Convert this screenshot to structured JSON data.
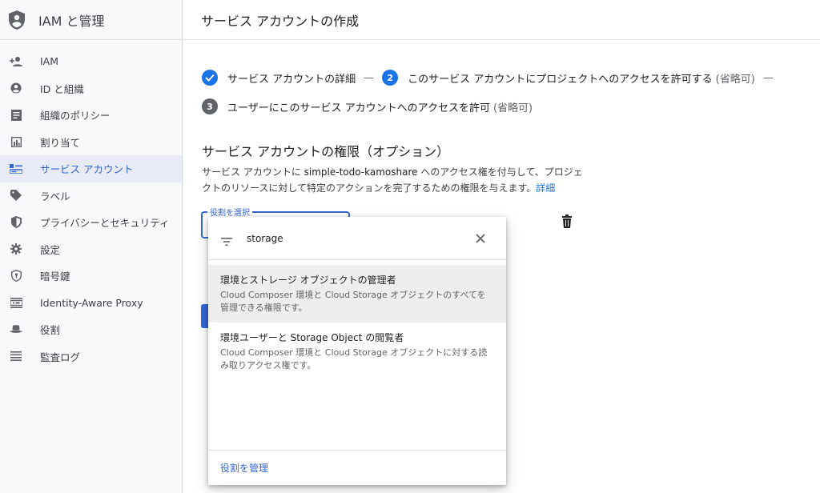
{
  "app": {
    "title": "IAM と管理",
    "page_title": "サービス アカウントの作成"
  },
  "sidebar": {
    "items": [
      {
        "label": "IAM",
        "icon": "person-add-icon"
      },
      {
        "label": "ID と組織",
        "icon": "account-circle-icon"
      },
      {
        "label": "組織のポリシー",
        "icon": "list-document-icon"
      },
      {
        "label": "割り当て",
        "icon": "quota-icon"
      },
      {
        "label": "サービス アカウント",
        "icon": "service-account-icon",
        "active": true
      },
      {
        "label": "ラベル",
        "icon": "label-icon"
      },
      {
        "label": "プライバシーとセキュリティ",
        "icon": "shield-icon"
      },
      {
        "label": "設定",
        "icon": "gear-icon"
      },
      {
        "label": "暗号鍵",
        "icon": "key-shield-icon"
      },
      {
        "label": "Identity-Aware Proxy",
        "icon": "proxy-icon"
      },
      {
        "label": "役割",
        "icon": "hat-icon"
      },
      {
        "label": "監査ログ",
        "icon": "log-lines-icon"
      }
    ]
  },
  "steps": {
    "step1": {
      "label": "サービス アカウントの詳細",
      "separator": "—"
    },
    "step2": {
      "number": "2",
      "label": "このサービス アカウントにプロジェクトへのアクセスを許可する",
      "optional": "(省略可)",
      "separator": "—"
    },
    "step3": {
      "number": "3",
      "label": "ユーザーにこのサービス アカウントへのアクセスを許可",
      "optional": "(省略可)"
    }
  },
  "section": {
    "title": "サービス アカウントの権限（オプション）",
    "desc_prefix": "サービス アカウントに ",
    "account": "simple-todo-kamoshare",
    "desc_suffix": " へのアクセス権を付与して、プロジェクトのリソースに対して特定のアクションを完了するための権限を与えます。",
    "details_link": "詳細"
  },
  "role_field": {
    "label": "役割を選択"
  },
  "dropdown": {
    "query": "storage",
    "options": [
      {
        "title": "環境とストレージ オブジェクトの管理者",
        "desc": "Cloud Composer 環境と Cloud Storage オブジェクトのすべてを管理できる権限です。"
      },
      {
        "title": "環境ユーザーと Storage Object の閲覧者",
        "desc": "Cloud Composer 環境と Cloud Storage オブジェクトに対する読み取りアクセス権です。"
      }
    ],
    "footer_link": "役割を管理"
  },
  "colors": {
    "accent": "#1a73e8",
    "active_nav_bg": "#e8eaf6",
    "link": "#3367d6"
  }
}
